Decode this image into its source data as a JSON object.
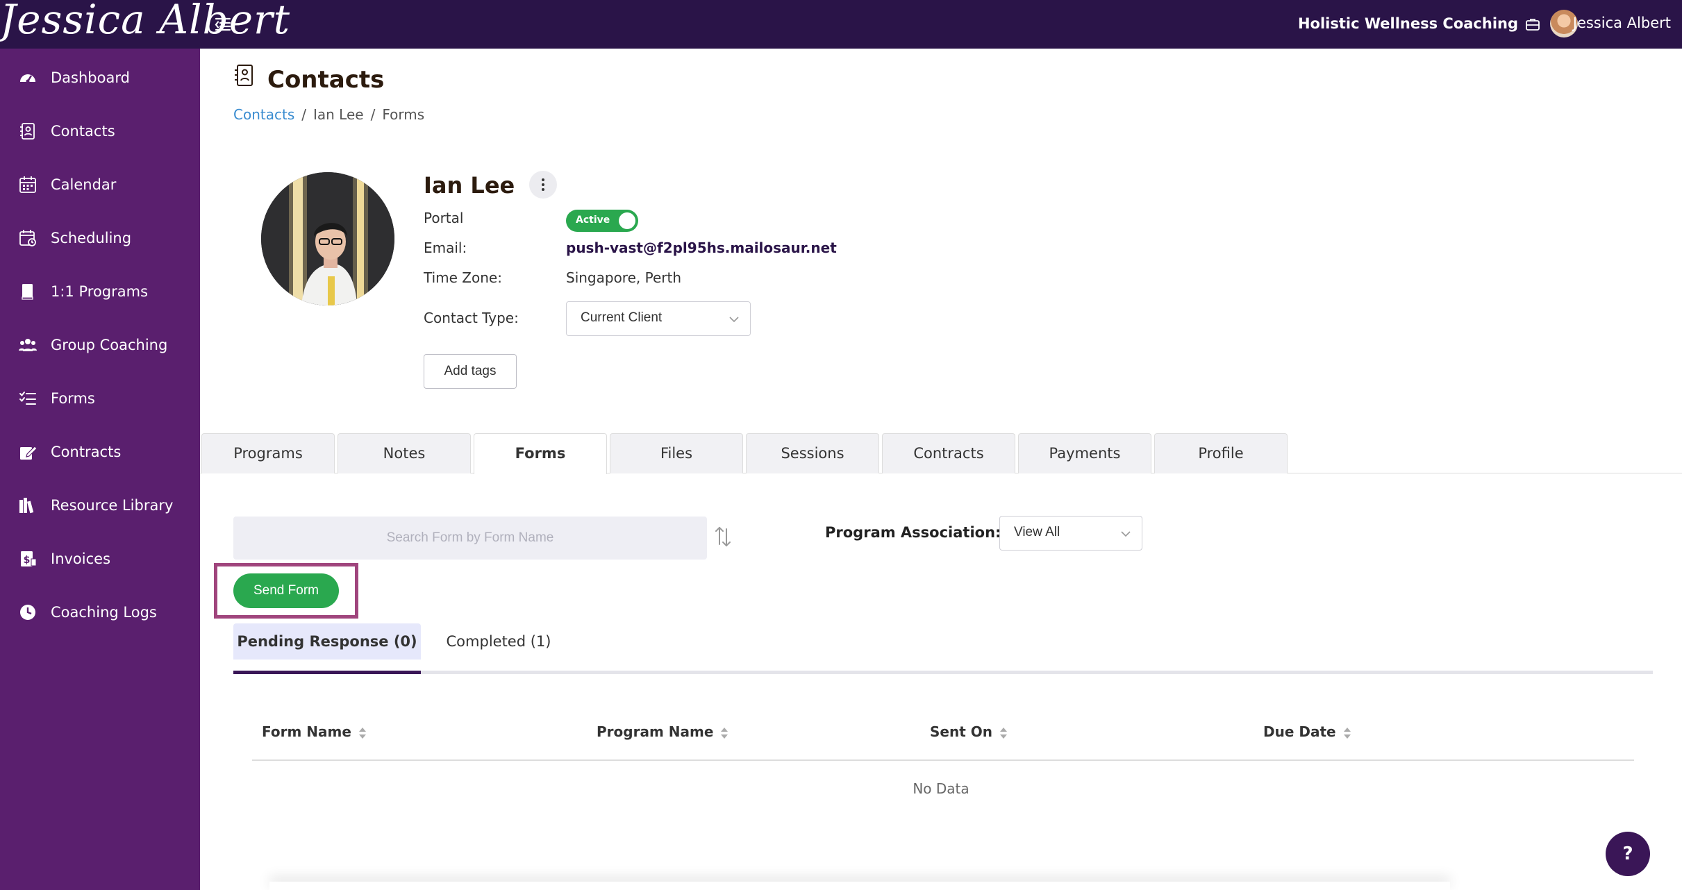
{
  "topbar": {
    "logo_text": "Jessica Albert",
    "org_name": "Holistic Wellness Coaching",
    "user_name": "Jessica Albert",
    "colors": {
      "bar": "#2a1448",
      "sidebar": "#5a1f6e",
      "accent_green": "#2aa84f",
      "highlight": "#a0457d"
    }
  },
  "sidebar": {
    "items": [
      {
        "label": "Dashboard",
        "icon": "dashboard-gauge-icon"
      },
      {
        "label": "Contacts",
        "icon": "contacts-book-icon"
      },
      {
        "label": "Calendar",
        "icon": "calendar-icon"
      },
      {
        "label": "Scheduling",
        "icon": "scheduling-calendar-clock-icon"
      },
      {
        "label": "1:1 Programs",
        "icon": "book-icon"
      },
      {
        "label": "Group Coaching",
        "icon": "group-users-icon"
      },
      {
        "label": "Forms",
        "icon": "checklist-icon"
      },
      {
        "label": "Contracts",
        "icon": "pen-signature-icon"
      },
      {
        "label": "Resource Library",
        "icon": "library-books-icon"
      },
      {
        "label": "Invoices",
        "icon": "invoice-dollar-icon"
      },
      {
        "label": "Coaching Logs",
        "icon": "clock-icon"
      }
    ]
  },
  "page": {
    "title": "Contacts",
    "breadcrumb": [
      "Contacts",
      "Ian Lee",
      "Forms"
    ],
    "breadcrumb_sep": "/"
  },
  "contact": {
    "name": "Ian Lee",
    "portal_label": "Portal",
    "portal_status": "Active",
    "email_label": "Email:",
    "email": "push-vast@f2pl95hs.mailosaur.net",
    "timezone_label": "Time Zone:",
    "timezone": "Singapore, Perth",
    "contact_type_label": "Contact Type:",
    "contact_type": "Current Client",
    "add_tags_label": "Add tags"
  },
  "tabs": [
    {
      "label": "Programs",
      "active": false
    },
    {
      "label": "Notes",
      "active": false
    },
    {
      "label": "Forms",
      "active": true
    },
    {
      "label": "Files",
      "active": false
    },
    {
      "label": "Sessions",
      "active": false
    },
    {
      "label": "Contracts",
      "active": false
    },
    {
      "label": "Payments",
      "active": false
    },
    {
      "label": "Profile",
      "active": false
    }
  ],
  "forms": {
    "search_placeholder": "Search Form by Form Name",
    "search_value": "",
    "program_association_label": "Program Association:",
    "program_association_value": "View All",
    "send_form_label": "Send Form",
    "subtabs": [
      {
        "label": "Pending Response (0)",
        "active": true
      },
      {
        "label": "Completed (1)",
        "active": false
      }
    ],
    "columns": [
      "Form Name",
      "Program Name",
      "Sent On",
      "Due Date"
    ],
    "rows": [],
    "empty_text": "No Data"
  },
  "help_label": "?"
}
